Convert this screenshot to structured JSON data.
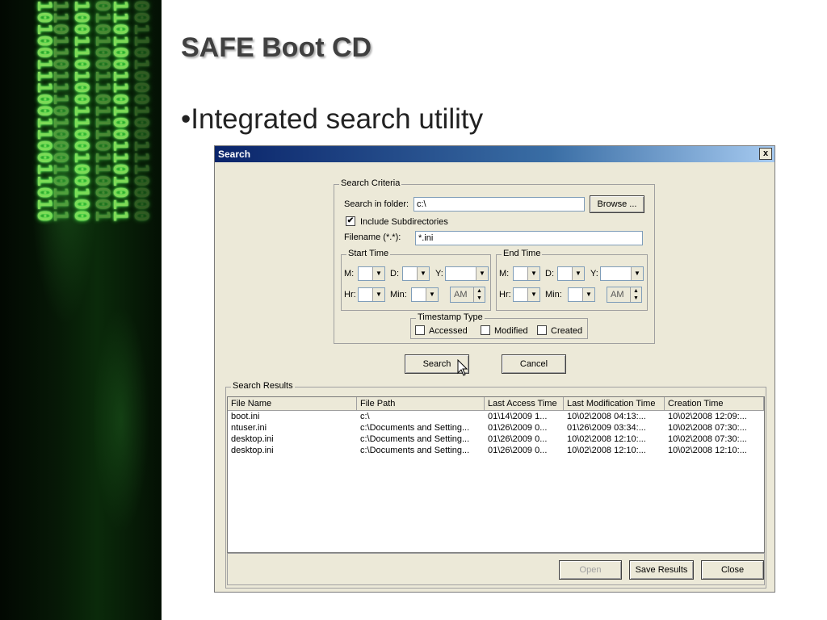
{
  "slide": {
    "title": "SAFE Boot CD",
    "bullet": "•Integrated search utility"
  },
  "decor": {
    "matrix_columns": [
      "1010011100110011010",
      "1101101110100010111",
      "1001101001100100100",
      "0101001101110110001",
      "1101001101001101011",
      "0011010001001110000"
    ]
  },
  "dialog": {
    "title": "Search",
    "close_glyph": "x",
    "criteria": {
      "legend": "Search Criteria",
      "folder_label": "Search in folder:",
      "folder_value": "c:\\",
      "browse_label": "Browse ...",
      "include_sub_label": "Include Subdirectories",
      "include_sub_checked": true,
      "filename_label": "Filename (*.*):",
      "filename_value": "*.ini"
    },
    "start_time": {
      "legend": "Start Time",
      "m_label": "M:",
      "d_label": "D:",
      "y_label": "Y:",
      "hr_label": "Hr:",
      "min_label": "Min:",
      "ampm": "AM"
    },
    "end_time": {
      "legend": "End Time",
      "m_label": "M:",
      "d_label": "D:",
      "y_label": "Y:",
      "hr_label": "Hr:",
      "min_label": "Min:",
      "ampm": "AM"
    },
    "timestamp": {
      "legend": "Timestamp Type",
      "accessed": "Accessed",
      "modified": "Modified",
      "created": "Created"
    },
    "search_label": "Search",
    "cancel_label": "Cancel",
    "results": {
      "legend": "Search Results",
      "columns": [
        "File Name",
        "File Path",
        "Last Access Time",
        "Last Modification Time",
        "Creation Time"
      ],
      "rows": [
        [
          "boot.ini",
          "c:\\",
          "01\\14\\2009 1...",
          "10\\02\\2008 04:13:...",
          "10\\02\\2008 12:09:..."
        ],
        [
          "ntuser.ini",
          "c:\\Documents and Setting...",
          "01\\26\\2009 0...",
          "01\\26\\2009 03:34:...",
          "10\\02\\2008 07:30:..."
        ],
        [
          "desktop.ini",
          "c:\\Documents and Setting...",
          "01\\26\\2009 0...",
          "10\\02\\2008 12:10:...",
          "10\\02\\2008 07:30:..."
        ],
        [
          "desktop.ini",
          "c:\\Documents and Setting...",
          "01\\26\\2009 0...",
          "10\\02\\2008 12:10:...",
          "10\\02\\2008 12:10:..."
        ]
      ]
    },
    "open_label": "Open",
    "save_results_label": "Save Results",
    "close_label": "Close",
    "colors": {
      "titlebar": "#0a246a",
      "face": "#ece9d8"
    }
  }
}
